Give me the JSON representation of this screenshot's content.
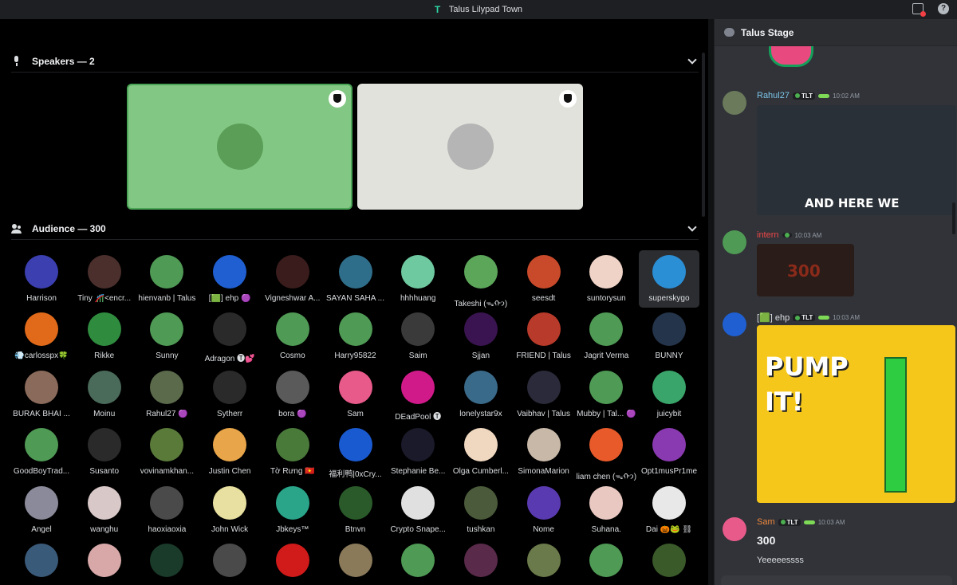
{
  "window": {
    "title": "Talus Lilypad Town"
  },
  "speakers": {
    "header": "Speakers — 2",
    "tiles": [
      {
        "bg": "#83c785",
        "avatar": "#5a9e57",
        "border": "#4aa556"
      },
      {
        "bg": "#e1e2dc",
        "avatar": "#b5b5b5",
        "border": "#e1e2dc"
      }
    ]
  },
  "audience": {
    "header": "Audience — 300",
    "rows": [
      [
        {
          "name": "Harrison",
          "color": "#3b3fb0"
        },
        {
          "name": "Tiny 🎢<encr...",
          "color": "#4a2f2c"
        },
        {
          "name": "hienvanb | Talus",
          "color": "#4f9a55"
        },
        {
          "name": "[🟩] ehp 🟣",
          "color": "#1f5fd1"
        },
        {
          "name": "Vigneshwar A...",
          "color": "#3a1c1c"
        },
        {
          "name": "SAYAN SAHA ...",
          "color": "#2f6e8a"
        },
        {
          "name": "hhhhuang",
          "color": "#6ec9a0"
        },
        {
          "name": "Takeshi (ᯓᡣ𐭩)",
          "color": "#5ca65a"
        },
        {
          "name": "seesdt",
          "color": "#c94a2a"
        },
        {
          "name": "suntorysun",
          "color": "#f0d3c7"
        },
        {
          "name": "superskygo",
          "color": "#2b8fd6"
        }
      ],
      [
        {
          "name": "💨carlosspx🍀",
          "color": "#e06a1a"
        },
        {
          "name": "Rikke",
          "color": "#2f8c3f"
        },
        {
          "name": "Sunny",
          "color": "#4f9a55"
        },
        {
          "name": "Adragon 🅣💕",
          "color": "#2a2a2a"
        },
        {
          "name": "Cosmo",
          "color": "#4f9a55"
        },
        {
          "name": "Harry95822",
          "color": "#4f9a55"
        },
        {
          "name": "Saim",
          "color": "#3a3a3a"
        },
        {
          "name": "Sjjan",
          "color": "#3a1450"
        },
        {
          "name": "FRIEND | Talus",
          "color": "#b83a2a"
        },
        {
          "name": "Jagrit Verma",
          "color": "#4f9a55"
        },
        {
          "name": "BUNNY",
          "color": "#24344a"
        }
      ],
      [
        {
          "name": "BURAK BHAI ...",
          "color": "#8a6a5a"
        },
        {
          "name": "Moinu",
          "color": "#4a6a5a"
        },
        {
          "name": "Rahul27 🟣",
          "color": "#5a6a4a"
        },
        {
          "name": "Sytherr",
          "color": "#2a2a2a"
        },
        {
          "name": "bora 🟣",
          "color": "#5a5a5a"
        },
        {
          "name": "Sam",
          "color": "#e85a8a"
        },
        {
          "name": "DEadPool 🅣",
          "color": "#d11a8a"
        },
        {
          "name": "lonelystar9x",
          "color": "#3a6a8a"
        },
        {
          "name": "Vaibhav | Talus",
          "color": "#2a2a3a"
        },
        {
          "name": "Mubby | Tal... 🟣",
          "color": "#4f9a55"
        },
        {
          "name": "juicybit",
          "color": "#3aa56a"
        }
      ],
      [
        {
          "name": "GoodBoyTrad...",
          "color": "#4f9a55"
        },
        {
          "name": "Susanto",
          "color": "#2a2a2a"
        },
        {
          "name": "vovinamkhan...",
          "color": "#5a7a3a"
        },
        {
          "name": "Justin Chen",
          "color": "#e8a54a"
        },
        {
          "name": "Tờ Rưng 🇻🇳",
          "color": "#4a7a3a"
        },
        {
          "name": "福利鸭|0xCry...",
          "color": "#1a5ad1"
        },
        {
          "name": "Stephanie Be...",
          "color": "#1a1a2a"
        },
        {
          "name": "Olga Cumberl...",
          "color": "#f0d8c0"
        },
        {
          "name": "SimonaMarion",
          "color": "#c8b8a8"
        },
        {
          "name": "liam chen (ᯓᡣ𐭩)",
          "color": "#e85a2a"
        },
        {
          "name": "Opt1musPr1me",
          "color": "#8a3ab0"
        }
      ],
      [
        {
          "name": "Angel",
          "color": "#8a8a9a"
        },
        {
          "name": "wanghu",
          "color": "#d8c8c8"
        },
        {
          "name": "haoxiaoxia",
          "color": "#4a4a4a"
        },
        {
          "name": "John Wick",
          "color": "#e8e0a0"
        },
        {
          "name": "Jbkeys™",
          "color": "#2aa58a"
        },
        {
          "name": "Btnvn",
          "color": "#2a5a2a"
        },
        {
          "name": "Crypto Snape...",
          "color": "#e0e0e0"
        },
        {
          "name": "tushkan",
          "color": "#4a5a3a"
        },
        {
          "name": "Nome",
          "color": "#5a3ab0"
        },
        {
          "name": "Suhana.",
          "color": "#e8c8c0"
        },
        {
          "name": "Dai 🎃🐸 ⛓",
          "color": "#e8e8e8"
        }
      ],
      [
        {
          "name": "",
          "color": "#3a5a7a"
        },
        {
          "name": "",
          "color": "#d8a8a8"
        },
        {
          "name": "",
          "color": "#1a3a2a"
        },
        {
          "name": "",
          "color": "#4a4a4a"
        },
        {
          "name": "",
          "color": "#d11a1a"
        },
        {
          "name": "",
          "color": "#8a7a5a"
        },
        {
          "name": "",
          "color": "#4f9a55"
        },
        {
          "name": "",
          "color": "#5a2a4a"
        },
        {
          "name": "",
          "color": "#6a7a4a"
        },
        {
          "name": "",
          "color": "#4f9a55"
        },
        {
          "name": "",
          "color": "#3a5a2a"
        }
      ]
    ]
  },
  "chat": {
    "title": "Talus Stage",
    "messages": [
      {
        "author": "Rahul27",
        "author_color": "#7cc4e8",
        "tag": "TLT",
        "time": "10:02 AM",
        "media_text": "AND HERE WE",
        "avatar": "#6a7a5a"
      },
      {
        "author": "intern",
        "author_color": "#f04747",
        "tag": "",
        "time": "10:03 AM",
        "media_text": "300",
        "avatar": "#4f9a55"
      },
      {
        "author": "[🟩] ehp",
        "author_color": "#dbdee1",
        "tag": "TLT",
        "time": "10:03 AM",
        "media_text": "PUMP IT!",
        "avatar": "#1f5fd1"
      },
      {
        "author": "Sam",
        "author_color": "#f0883e",
        "tag": "TLT",
        "time": "10:03 AM",
        "line1": "300",
        "line2": "Yeeeeessss",
        "avatar": "#e85a8a"
      }
    ]
  },
  "colors": {
    "accent": "#5865f2",
    "bg": "#000000",
    "panel": "#313338"
  },
  "icons": [
    "app-logo-icon",
    "inbox-icon",
    "help-icon",
    "mic-icon",
    "people-icon",
    "chevron-down-icon",
    "shield-icon",
    "chat-bubble-icon"
  ]
}
